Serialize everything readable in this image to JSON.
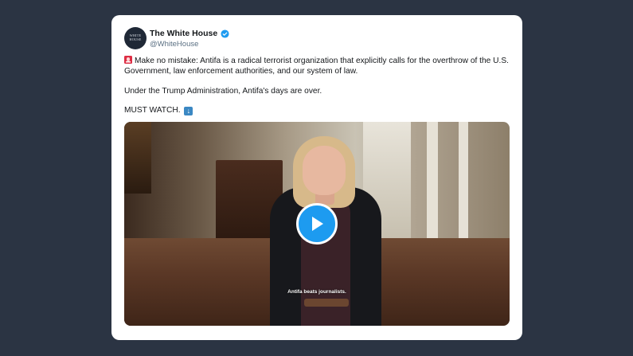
{
  "tweet": {
    "avatar_text": [
      "WHITE",
      "HOUSE"
    ],
    "display_name": "The White House",
    "handle": "@WhiteHouse",
    "verified_icon": "verified-badge-icon",
    "line1_emoji": "police-siren-icon",
    "line1": "Make no mistake: Antifa is a radical terrorist organization that explicitly calls for the overthrow of the U.S. Government, law enforcement authorities, and our system of law.",
    "line2": "Under the Trump Administration, Antifa's days are over.",
    "line3": "MUST WATCH.",
    "line3_emoji": "down-arrow-icon"
  },
  "video": {
    "caption": "Antifa beats journalists.",
    "play_icon": "play-icon"
  },
  "colors": {
    "background": "#2b3443",
    "card": "#ffffff",
    "accent": "#1d9bf0",
    "secondary_text": "#5b7083"
  }
}
